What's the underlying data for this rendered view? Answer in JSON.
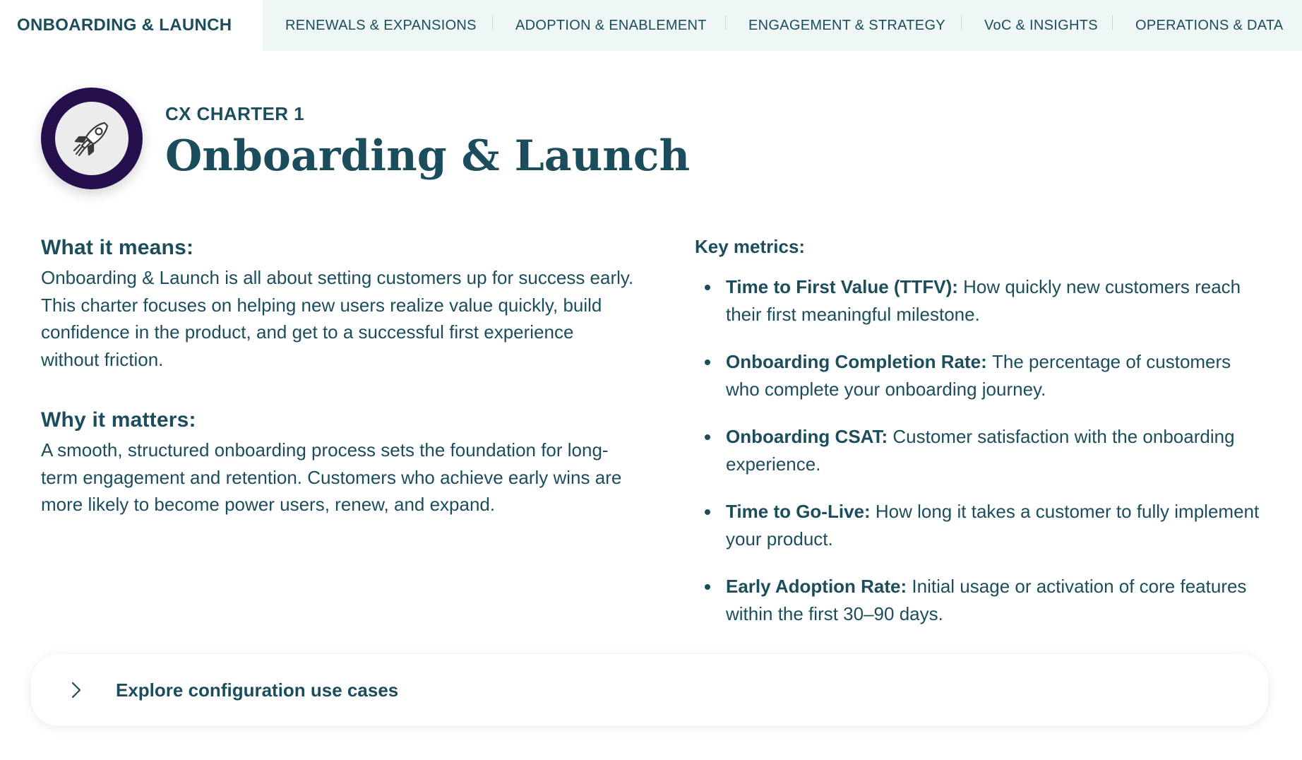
{
  "tabs": [
    {
      "label": "ONBOARDING & LAUNCH",
      "active": true
    },
    {
      "label": "RENEWALS & EXPANSIONS",
      "active": false
    },
    {
      "label": "ADOPTION & ENABLEMENT",
      "active": false
    },
    {
      "label": "ENGAGEMENT & STRATEGY",
      "active": false
    },
    {
      "label": "VoC & INSIGHTS",
      "active": false
    },
    {
      "label": "OPERATIONS & DATA",
      "active": false
    }
  ],
  "header": {
    "eyebrow": "CX CHARTER 1",
    "title": "Onboarding & Launch",
    "icon": "rocket-icon"
  },
  "sections": {
    "what_it_means": {
      "heading": "What it means:",
      "body": "Onboarding & Launch is all about setting customers up for success early. This charter focuses on helping new users realize value quickly, build confidence in the product, and get to a successful first experience without friction."
    },
    "why_it_matters": {
      "heading": "Why it matters:",
      "body": "A smooth, structured onboarding process sets the foundation for long-term engagement and retention. Customers who achieve early wins are more likely to become power users, renew, and expand."
    }
  },
  "metrics": {
    "heading": "Key metrics:",
    "items": [
      {
        "name": "Time to First Value (TTFV):",
        "desc": "How quickly new customers reach their first meaningful milestone."
      },
      {
        "name": "Onboarding Completion Rate:",
        "desc": "The percentage of customers who complete your onboarding journey."
      },
      {
        "name": "Onboarding CSAT:",
        "desc": "Customer satisfaction with the onboarding experience."
      },
      {
        "name": "Time to Go-Live:",
        "desc": "How long it takes a customer to fully implement your product."
      },
      {
        "name": "Early Adoption Rate:",
        "desc": "Initial usage or activation of core features within the first 30–90 days."
      }
    ]
  },
  "accordion": {
    "label": "Explore configuration use cases",
    "icon": "chevron-right-icon",
    "expanded": false
  },
  "colors": {
    "primary_text": "#1c4d5c",
    "tab_bar_bg": "#eef7f6",
    "badge_ring": "#25104d",
    "badge_inner": "#ececec"
  }
}
